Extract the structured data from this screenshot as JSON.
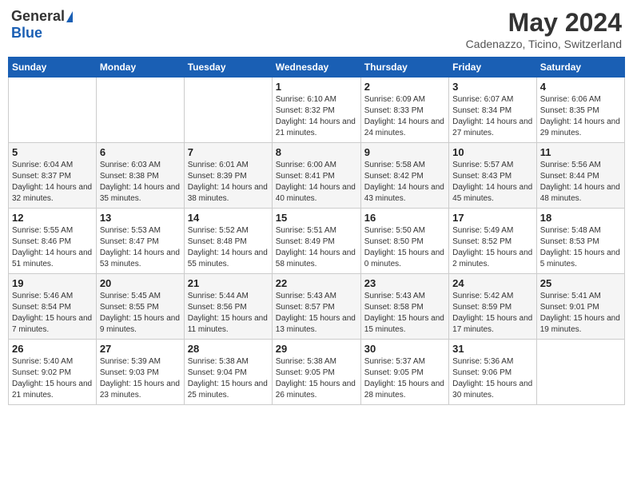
{
  "logo": {
    "general": "General",
    "blue": "Blue"
  },
  "title": "May 2024",
  "location": "Cadenazzo, Ticino, Switzerland",
  "days_of_week": [
    "Sunday",
    "Monday",
    "Tuesday",
    "Wednesday",
    "Thursday",
    "Friday",
    "Saturday"
  ],
  "weeks": [
    [
      {
        "day": "",
        "info": ""
      },
      {
        "day": "",
        "info": ""
      },
      {
        "day": "",
        "info": ""
      },
      {
        "day": "1",
        "info": "Sunrise: 6:10 AM\nSunset: 8:32 PM\nDaylight: 14 hours and 21 minutes."
      },
      {
        "day": "2",
        "info": "Sunrise: 6:09 AM\nSunset: 8:33 PM\nDaylight: 14 hours and 24 minutes."
      },
      {
        "day": "3",
        "info": "Sunrise: 6:07 AM\nSunset: 8:34 PM\nDaylight: 14 hours and 27 minutes."
      },
      {
        "day": "4",
        "info": "Sunrise: 6:06 AM\nSunset: 8:35 PM\nDaylight: 14 hours and 29 minutes."
      }
    ],
    [
      {
        "day": "5",
        "info": "Sunrise: 6:04 AM\nSunset: 8:37 PM\nDaylight: 14 hours and 32 minutes."
      },
      {
        "day": "6",
        "info": "Sunrise: 6:03 AM\nSunset: 8:38 PM\nDaylight: 14 hours and 35 minutes."
      },
      {
        "day": "7",
        "info": "Sunrise: 6:01 AM\nSunset: 8:39 PM\nDaylight: 14 hours and 38 minutes."
      },
      {
        "day": "8",
        "info": "Sunrise: 6:00 AM\nSunset: 8:41 PM\nDaylight: 14 hours and 40 minutes."
      },
      {
        "day": "9",
        "info": "Sunrise: 5:58 AM\nSunset: 8:42 PM\nDaylight: 14 hours and 43 minutes."
      },
      {
        "day": "10",
        "info": "Sunrise: 5:57 AM\nSunset: 8:43 PM\nDaylight: 14 hours and 45 minutes."
      },
      {
        "day": "11",
        "info": "Sunrise: 5:56 AM\nSunset: 8:44 PM\nDaylight: 14 hours and 48 minutes."
      }
    ],
    [
      {
        "day": "12",
        "info": "Sunrise: 5:55 AM\nSunset: 8:46 PM\nDaylight: 14 hours and 51 minutes."
      },
      {
        "day": "13",
        "info": "Sunrise: 5:53 AM\nSunset: 8:47 PM\nDaylight: 14 hours and 53 minutes."
      },
      {
        "day": "14",
        "info": "Sunrise: 5:52 AM\nSunset: 8:48 PM\nDaylight: 14 hours and 55 minutes."
      },
      {
        "day": "15",
        "info": "Sunrise: 5:51 AM\nSunset: 8:49 PM\nDaylight: 14 hours and 58 minutes."
      },
      {
        "day": "16",
        "info": "Sunrise: 5:50 AM\nSunset: 8:50 PM\nDaylight: 15 hours and 0 minutes."
      },
      {
        "day": "17",
        "info": "Sunrise: 5:49 AM\nSunset: 8:52 PM\nDaylight: 15 hours and 2 minutes."
      },
      {
        "day": "18",
        "info": "Sunrise: 5:48 AM\nSunset: 8:53 PM\nDaylight: 15 hours and 5 minutes."
      }
    ],
    [
      {
        "day": "19",
        "info": "Sunrise: 5:46 AM\nSunset: 8:54 PM\nDaylight: 15 hours and 7 minutes."
      },
      {
        "day": "20",
        "info": "Sunrise: 5:45 AM\nSunset: 8:55 PM\nDaylight: 15 hours and 9 minutes."
      },
      {
        "day": "21",
        "info": "Sunrise: 5:44 AM\nSunset: 8:56 PM\nDaylight: 15 hours and 11 minutes."
      },
      {
        "day": "22",
        "info": "Sunrise: 5:43 AM\nSunset: 8:57 PM\nDaylight: 15 hours and 13 minutes."
      },
      {
        "day": "23",
        "info": "Sunrise: 5:43 AM\nSunset: 8:58 PM\nDaylight: 15 hours and 15 minutes."
      },
      {
        "day": "24",
        "info": "Sunrise: 5:42 AM\nSunset: 8:59 PM\nDaylight: 15 hours and 17 minutes."
      },
      {
        "day": "25",
        "info": "Sunrise: 5:41 AM\nSunset: 9:01 PM\nDaylight: 15 hours and 19 minutes."
      }
    ],
    [
      {
        "day": "26",
        "info": "Sunrise: 5:40 AM\nSunset: 9:02 PM\nDaylight: 15 hours and 21 minutes."
      },
      {
        "day": "27",
        "info": "Sunrise: 5:39 AM\nSunset: 9:03 PM\nDaylight: 15 hours and 23 minutes."
      },
      {
        "day": "28",
        "info": "Sunrise: 5:38 AM\nSunset: 9:04 PM\nDaylight: 15 hours and 25 minutes."
      },
      {
        "day": "29",
        "info": "Sunrise: 5:38 AM\nSunset: 9:05 PM\nDaylight: 15 hours and 26 minutes."
      },
      {
        "day": "30",
        "info": "Sunrise: 5:37 AM\nSunset: 9:05 PM\nDaylight: 15 hours and 28 minutes."
      },
      {
        "day": "31",
        "info": "Sunrise: 5:36 AM\nSunset: 9:06 PM\nDaylight: 15 hours and 30 minutes."
      },
      {
        "day": "",
        "info": ""
      }
    ]
  ]
}
